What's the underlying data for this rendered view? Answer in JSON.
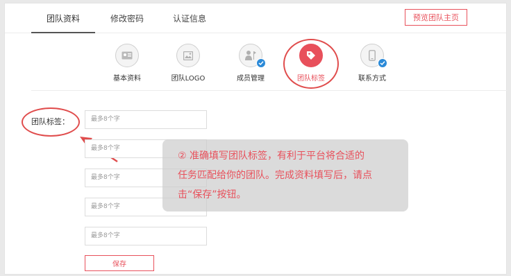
{
  "tabs": [
    {
      "label": "团队资料",
      "active": true
    },
    {
      "label": "修改密码",
      "active": false
    },
    {
      "label": "认证信息",
      "active": false
    }
  ],
  "preview_button": "预览团队主页",
  "steps": [
    {
      "label": "基本资料",
      "icon": "id-card-icon",
      "completed": false,
      "active": false
    },
    {
      "label": "团队LOGO",
      "icon": "image-icon",
      "completed": false,
      "active": false
    },
    {
      "label": "成员管理",
      "icon": "member-icon",
      "completed": true,
      "active": false
    },
    {
      "label": "团队标签",
      "icon": "tag-icon",
      "completed": false,
      "active": true
    },
    {
      "label": "联系方式",
      "icon": "phone-icon",
      "completed": true,
      "active": false
    }
  ],
  "form": {
    "label": "团队标签：",
    "inputs": [
      {
        "placeholder": "最多8个字",
        "value": ""
      },
      {
        "placeholder": "最多8个字",
        "value": ""
      },
      {
        "placeholder": "最多8个字",
        "value": ""
      },
      {
        "placeholder": "最多8个字",
        "value": ""
      },
      {
        "placeholder": "最多8个字",
        "value": ""
      }
    ],
    "save_label": "保存"
  },
  "tooltip": {
    "line1": "② 准确填写团队标签，有利于平台将合适的",
    "line2": "任务匹配给你的团队。完成资料填写后，请点",
    "line3": "击“保存”按钮。"
  },
  "colors": {
    "accent": "#e8505b",
    "annotation": "#e04c4c",
    "check": "#2b8ad8"
  }
}
